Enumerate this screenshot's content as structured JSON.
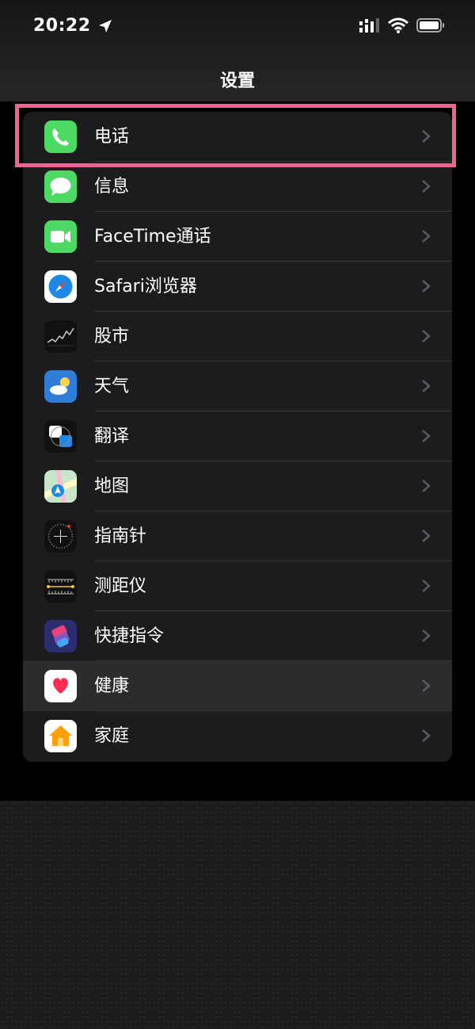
{
  "status_bar": {
    "time": "20:22"
  },
  "nav": {
    "title": "设置"
  },
  "items": [
    {
      "label": "电话",
      "icon": "phone-icon"
    },
    {
      "label": "信息",
      "icon": "messages-icon"
    },
    {
      "label": "FaceTime通话",
      "icon": "facetime-icon"
    },
    {
      "label": "Safari浏览器",
      "icon": "safari-icon"
    },
    {
      "label": "股市",
      "icon": "stocks-icon"
    },
    {
      "label": "天气",
      "icon": "weather-icon"
    },
    {
      "label": "翻译",
      "icon": "translate-icon"
    },
    {
      "label": "地图",
      "icon": "maps-icon"
    },
    {
      "label": "指南针",
      "icon": "compass-icon"
    },
    {
      "label": "测距仪",
      "icon": "measure-icon"
    },
    {
      "label": "快捷指令",
      "icon": "shortcuts-icon"
    },
    {
      "label": "健康",
      "icon": "health-icon"
    },
    {
      "label": "家庭",
      "icon": "home-icon"
    }
  ],
  "colors": {
    "highlight": "#f06292",
    "group_bg": "#1c1c1e",
    "pressed_row": "#2c2c2e"
  }
}
